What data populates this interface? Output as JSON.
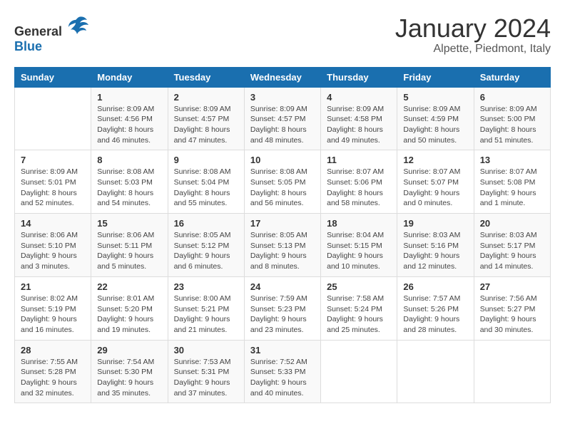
{
  "header": {
    "logo_general": "General",
    "logo_blue": "Blue",
    "month_title": "January 2024",
    "location": "Alpette, Piedmont, Italy"
  },
  "days_of_week": [
    "Sunday",
    "Monday",
    "Tuesday",
    "Wednesday",
    "Thursday",
    "Friday",
    "Saturday"
  ],
  "weeks": [
    [
      {
        "day": "",
        "sunrise": "",
        "sunset": "",
        "daylight": ""
      },
      {
        "day": "1",
        "sunrise": "Sunrise: 8:09 AM",
        "sunset": "Sunset: 4:56 PM",
        "daylight": "Daylight: 8 hours and 46 minutes."
      },
      {
        "day": "2",
        "sunrise": "Sunrise: 8:09 AM",
        "sunset": "Sunset: 4:57 PM",
        "daylight": "Daylight: 8 hours and 47 minutes."
      },
      {
        "day": "3",
        "sunrise": "Sunrise: 8:09 AM",
        "sunset": "Sunset: 4:57 PM",
        "daylight": "Daylight: 8 hours and 48 minutes."
      },
      {
        "day": "4",
        "sunrise": "Sunrise: 8:09 AM",
        "sunset": "Sunset: 4:58 PM",
        "daylight": "Daylight: 8 hours and 49 minutes."
      },
      {
        "day": "5",
        "sunrise": "Sunrise: 8:09 AM",
        "sunset": "Sunset: 4:59 PM",
        "daylight": "Daylight: 8 hours and 50 minutes."
      },
      {
        "day": "6",
        "sunrise": "Sunrise: 8:09 AM",
        "sunset": "Sunset: 5:00 PM",
        "daylight": "Daylight: 8 hours and 51 minutes."
      }
    ],
    [
      {
        "day": "7",
        "sunrise": "Sunrise: 8:09 AM",
        "sunset": "Sunset: 5:01 PM",
        "daylight": "Daylight: 8 hours and 52 minutes."
      },
      {
        "day": "8",
        "sunrise": "Sunrise: 8:08 AM",
        "sunset": "Sunset: 5:03 PM",
        "daylight": "Daylight: 8 hours and 54 minutes."
      },
      {
        "day": "9",
        "sunrise": "Sunrise: 8:08 AM",
        "sunset": "Sunset: 5:04 PM",
        "daylight": "Daylight: 8 hours and 55 minutes."
      },
      {
        "day": "10",
        "sunrise": "Sunrise: 8:08 AM",
        "sunset": "Sunset: 5:05 PM",
        "daylight": "Daylight: 8 hours and 56 minutes."
      },
      {
        "day": "11",
        "sunrise": "Sunrise: 8:07 AM",
        "sunset": "Sunset: 5:06 PM",
        "daylight": "Daylight: 8 hours and 58 minutes."
      },
      {
        "day": "12",
        "sunrise": "Sunrise: 8:07 AM",
        "sunset": "Sunset: 5:07 PM",
        "daylight": "Daylight: 9 hours and 0 minutes."
      },
      {
        "day": "13",
        "sunrise": "Sunrise: 8:07 AM",
        "sunset": "Sunset: 5:08 PM",
        "daylight": "Daylight: 9 hours and 1 minute."
      }
    ],
    [
      {
        "day": "14",
        "sunrise": "Sunrise: 8:06 AM",
        "sunset": "Sunset: 5:10 PM",
        "daylight": "Daylight: 9 hours and 3 minutes."
      },
      {
        "day": "15",
        "sunrise": "Sunrise: 8:06 AM",
        "sunset": "Sunset: 5:11 PM",
        "daylight": "Daylight: 9 hours and 5 minutes."
      },
      {
        "day": "16",
        "sunrise": "Sunrise: 8:05 AM",
        "sunset": "Sunset: 5:12 PM",
        "daylight": "Daylight: 9 hours and 6 minutes."
      },
      {
        "day": "17",
        "sunrise": "Sunrise: 8:05 AM",
        "sunset": "Sunset: 5:13 PM",
        "daylight": "Daylight: 9 hours and 8 minutes."
      },
      {
        "day": "18",
        "sunrise": "Sunrise: 8:04 AM",
        "sunset": "Sunset: 5:15 PM",
        "daylight": "Daylight: 9 hours and 10 minutes."
      },
      {
        "day": "19",
        "sunrise": "Sunrise: 8:03 AM",
        "sunset": "Sunset: 5:16 PM",
        "daylight": "Daylight: 9 hours and 12 minutes."
      },
      {
        "day": "20",
        "sunrise": "Sunrise: 8:03 AM",
        "sunset": "Sunset: 5:17 PM",
        "daylight": "Daylight: 9 hours and 14 minutes."
      }
    ],
    [
      {
        "day": "21",
        "sunrise": "Sunrise: 8:02 AM",
        "sunset": "Sunset: 5:19 PM",
        "daylight": "Daylight: 9 hours and 16 minutes."
      },
      {
        "day": "22",
        "sunrise": "Sunrise: 8:01 AM",
        "sunset": "Sunset: 5:20 PM",
        "daylight": "Daylight: 9 hours and 19 minutes."
      },
      {
        "day": "23",
        "sunrise": "Sunrise: 8:00 AM",
        "sunset": "Sunset: 5:21 PM",
        "daylight": "Daylight: 9 hours and 21 minutes."
      },
      {
        "day": "24",
        "sunrise": "Sunrise: 7:59 AM",
        "sunset": "Sunset: 5:23 PM",
        "daylight": "Daylight: 9 hours and 23 minutes."
      },
      {
        "day": "25",
        "sunrise": "Sunrise: 7:58 AM",
        "sunset": "Sunset: 5:24 PM",
        "daylight": "Daylight: 9 hours and 25 minutes."
      },
      {
        "day": "26",
        "sunrise": "Sunrise: 7:57 AM",
        "sunset": "Sunset: 5:26 PM",
        "daylight": "Daylight: 9 hours and 28 minutes."
      },
      {
        "day": "27",
        "sunrise": "Sunrise: 7:56 AM",
        "sunset": "Sunset: 5:27 PM",
        "daylight": "Daylight: 9 hours and 30 minutes."
      }
    ],
    [
      {
        "day": "28",
        "sunrise": "Sunrise: 7:55 AM",
        "sunset": "Sunset: 5:28 PM",
        "daylight": "Daylight: 9 hours and 32 minutes."
      },
      {
        "day": "29",
        "sunrise": "Sunrise: 7:54 AM",
        "sunset": "Sunset: 5:30 PM",
        "daylight": "Daylight: 9 hours and 35 minutes."
      },
      {
        "day": "30",
        "sunrise": "Sunrise: 7:53 AM",
        "sunset": "Sunset: 5:31 PM",
        "daylight": "Daylight: 9 hours and 37 minutes."
      },
      {
        "day": "31",
        "sunrise": "Sunrise: 7:52 AM",
        "sunset": "Sunset: 5:33 PM",
        "daylight": "Daylight: 9 hours and 40 minutes."
      },
      {
        "day": "",
        "sunrise": "",
        "sunset": "",
        "daylight": ""
      },
      {
        "day": "",
        "sunrise": "",
        "sunset": "",
        "daylight": ""
      },
      {
        "day": "",
        "sunrise": "",
        "sunset": "",
        "daylight": ""
      }
    ]
  ]
}
